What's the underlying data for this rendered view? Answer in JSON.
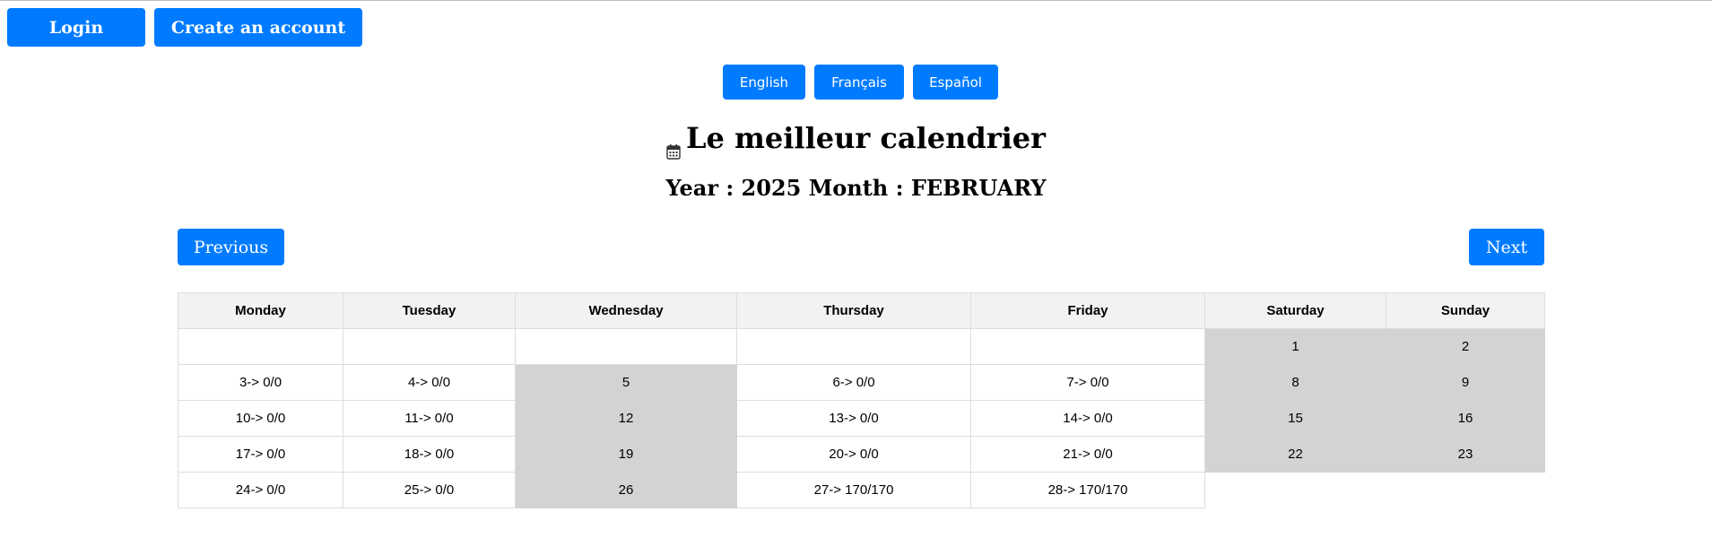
{
  "auth": {
    "login_label": "Login",
    "create_account_label": "Create an account"
  },
  "languages": {
    "english": "English",
    "francais": "Français",
    "espanol": "Español"
  },
  "header": {
    "icon": "calendar-icon",
    "title": "Le meilleur calendrier",
    "subtitle": "Year : 2025 Month : FEBRUARY"
  },
  "nav": {
    "previous_label": "Previous",
    "next_label": "Next"
  },
  "colors": {
    "accent": "#007bff",
    "header_bg": "#f2f2f2",
    "unavailable_bg": "#d3d3d3"
  },
  "calendar": {
    "headers": [
      "Monday",
      "Tuesday",
      "Wednesday",
      "Thursday",
      "Friday",
      "Saturday",
      "Sunday"
    ],
    "rows": [
      [
        {
          "text": "",
          "grey": false
        },
        {
          "text": "",
          "grey": false
        },
        {
          "text": "",
          "grey": false
        },
        {
          "text": "",
          "grey": false
        },
        {
          "text": "",
          "grey": false
        },
        {
          "text": "1",
          "grey": true
        },
        {
          "text": "2",
          "grey": true
        }
      ],
      [
        {
          "text": "3-> 0/0",
          "grey": false
        },
        {
          "text": "4-> 0/0",
          "grey": false
        },
        {
          "text": "5",
          "grey": true
        },
        {
          "text": "6-> 0/0",
          "grey": false
        },
        {
          "text": "7-> 0/0",
          "grey": false
        },
        {
          "text": "8",
          "grey": true
        },
        {
          "text": "9",
          "grey": true
        }
      ],
      [
        {
          "text": "10-> 0/0",
          "grey": false
        },
        {
          "text": "11-> 0/0",
          "grey": false
        },
        {
          "text": "12",
          "grey": true
        },
        {
          "text": "13-> 0/0",
          "grey": false
        },
        {
          "text": "14-> 0/0",
          "grey": false
        },
        {
          "text": "15",
          "grey": true
        },
        {
          "text": "16",
          "grey": true
        }
      ],
      [
        {
          "text": "17-> 0/0",
          "grey": false
        },
        {
          "text": "18-> 0/0",
          "grey": false
        },
        {
          "text": "19",
          "grey": true
        },
        {
          "text": "20-> 0/0",
          "grey": false
        },
        {
          "text": "21-> 0/0",
          "grey": false
        },
        {
          "text": "22",
          "grey": true
        },
        {
          "text": "23",
          "grey": true
        }
      ],
      [
        {
          "text": "24-> 0/0",
          "grey": false
        },
        {
          "text": "25-> 0/0",
          "grey": false
        },
        {
          "text": "26",
          "grey": true
        },
        {
          "text": "27-> 170/170",
          "grey": false
        },
        {
          "text": "28-> 170/170",
          "grey": false
        },
        {
          "text": "",
          "grey": false,
          "outside": true
        },
        {
          "text": "",
          "grey": false,
          "outside": true
        }
      ]
    ]
  }
}
